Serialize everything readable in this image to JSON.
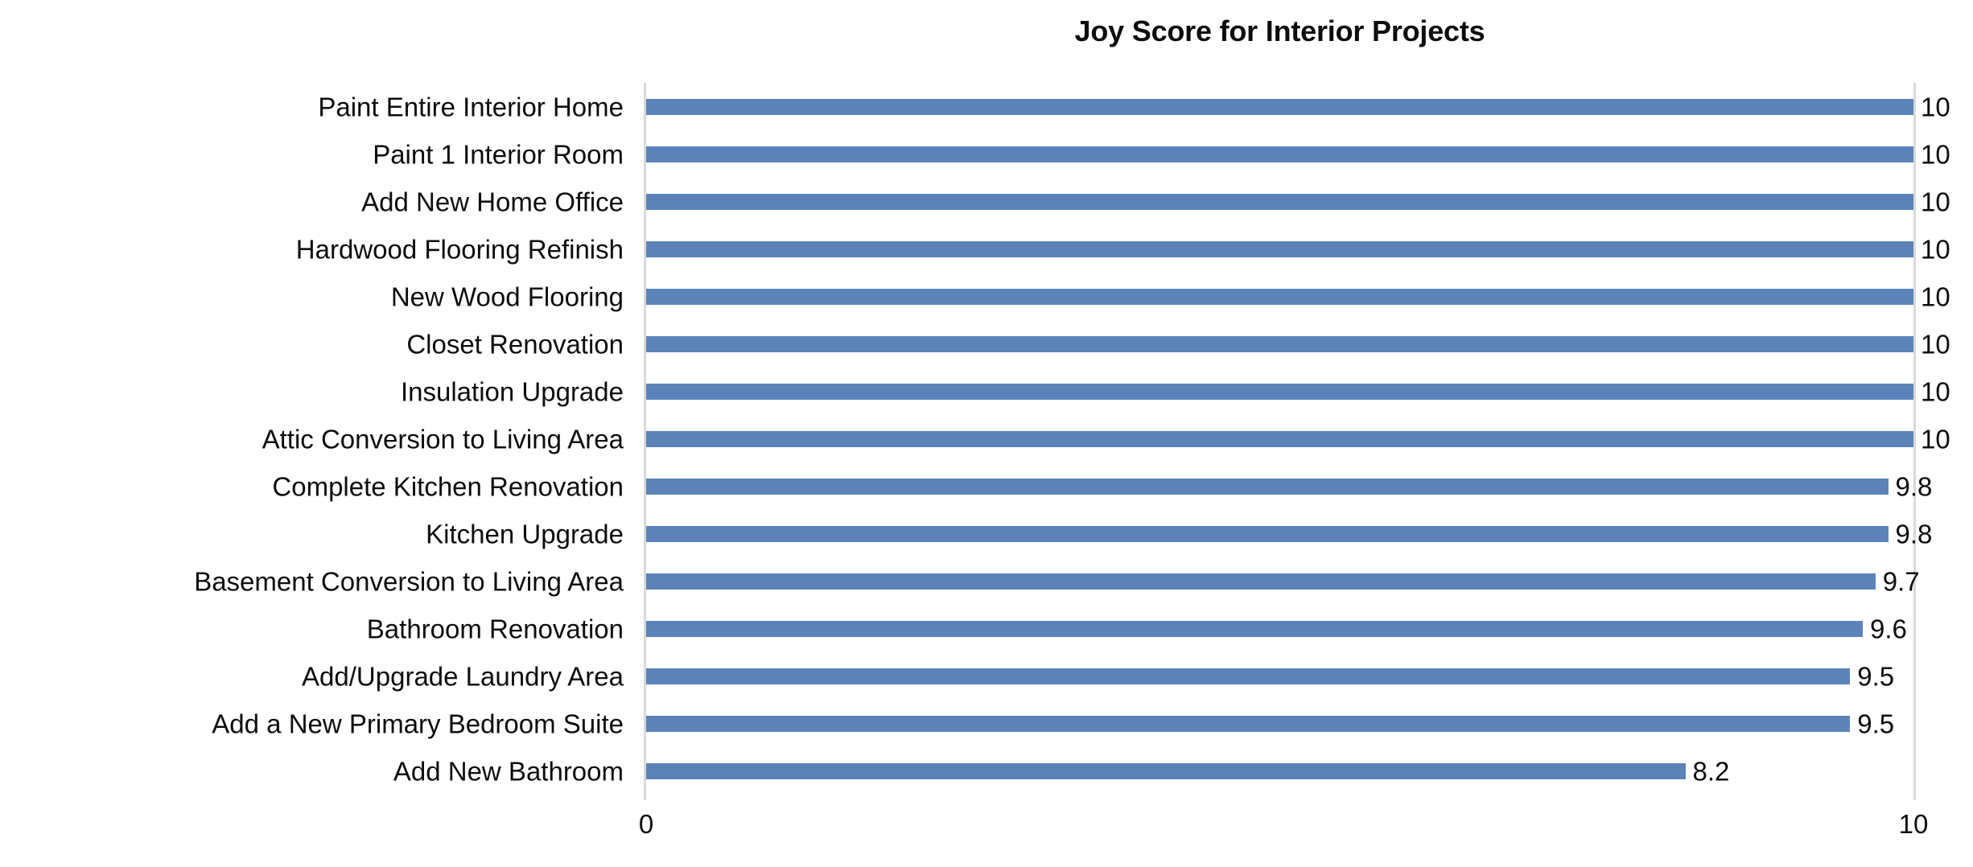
{
  "chart": {
    "title": "Joy Score for Interior Projects"
  },
  "axis": {
    "x_ticks": [
      "0",
      "10"
    ]
  },
  "chart_data": {
    "type": "bar",
    "orientation": "horizontal",
    "title": "Joy Score for Interior Projects",
    "xlabel": "",
    "ylabel": "",
    "xlim": [
      0,
      10
    ],
    "grid": false,
    "legend": false,
    "bar_color": "#5b83ba",
    "text_color": "#0d0d0d",
    "axis_color": "#d9d9d9",
    "xtick_labels": [
      "0",
      "10"
    ],
    "categories": [
      "Paint Entire Interior Home",
      "Paint 1 Interior Room",
      "Add New Home Office",
      "Hardwood Flooring Refinish",
      "New Wood Flooring",
      "Closet Renovation",
      "Insulation Upgrade",
      "Attic Conversion to Living Area",
      "Complete Kitchen Renovation",
      "Kitchen Upgrade",
      "Basement Conversion to Living Area",
      "Bathroom Renovation",
      "Add/Upgrade Laundry Area",
      "Add a New Primary Bedroom Suite",
      "Add New Bathroom"
    ],
    "values": [
      10,
      10,
      10,
      10,
      10,
      10,
      10,
      10,
      9.8,
      9.8,
      9.7,
      9.6,
      9.5,
      9.5,
      8.2
    ],
    "value_labels": [
      "10",
      "10",
      "10",
      "10",
      "10",
      "10",
      "10",
      "10",
      "9.8",
      "9.8",
      "9.7",
      "9.6",
      "9.5",
      "9.5",
      "8.2"
    ]
  }
}
